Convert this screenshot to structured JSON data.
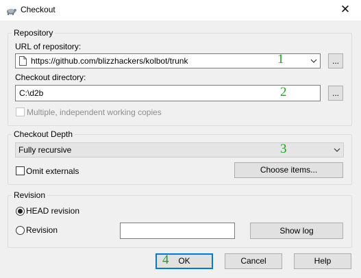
{
  "window": {
    "title": "Checkout",
    "close_symbol": "✕"
  },
  "repository": {
    "group_label": "Repository",
    "url_label": "URL of repository:",
    "url_value": "https://github.com/blizzhackers/kolbot/trunk",
    "url_browse_label": "...",
    "dir_label": "Checkout directory:",
    "dir_value": "C:\\d2b",
    "dir_browse_label": "...",
    "multiple_copies_label": "Multiple, independent working copies",
    "multiple_copies_checked": false,
    "multiple_copies_enabled": false
  },
  "depth": {
    "group_label": "Checkout Depth",
    "selected": "Fully recursive",
    "omit_externals_label": "Omit externals",
    "omit_externals_checked": false,
    "choose_items_label": "Choose items..."
  },
  "revision": {
    "group_label": "Revision",
    "head_label": "HEAD revision",
    "head_selected": true,
    "revision_label": "Revision",
    "revision_value": "",
    "show_log_label": "Show log"
  },
  "footer": {
    "ok_label": "OK",
    "cancel_label": "Cancel",
    "help_label": "Help"
  },
  "annotations": [
    "1",
    "2",
    "3",
    "4"
  ],
  "colors": {
    "annotation": "#22a022",
    "focus_border": "#0078d7",
    "background": "#f0f0f0"
  }
}
